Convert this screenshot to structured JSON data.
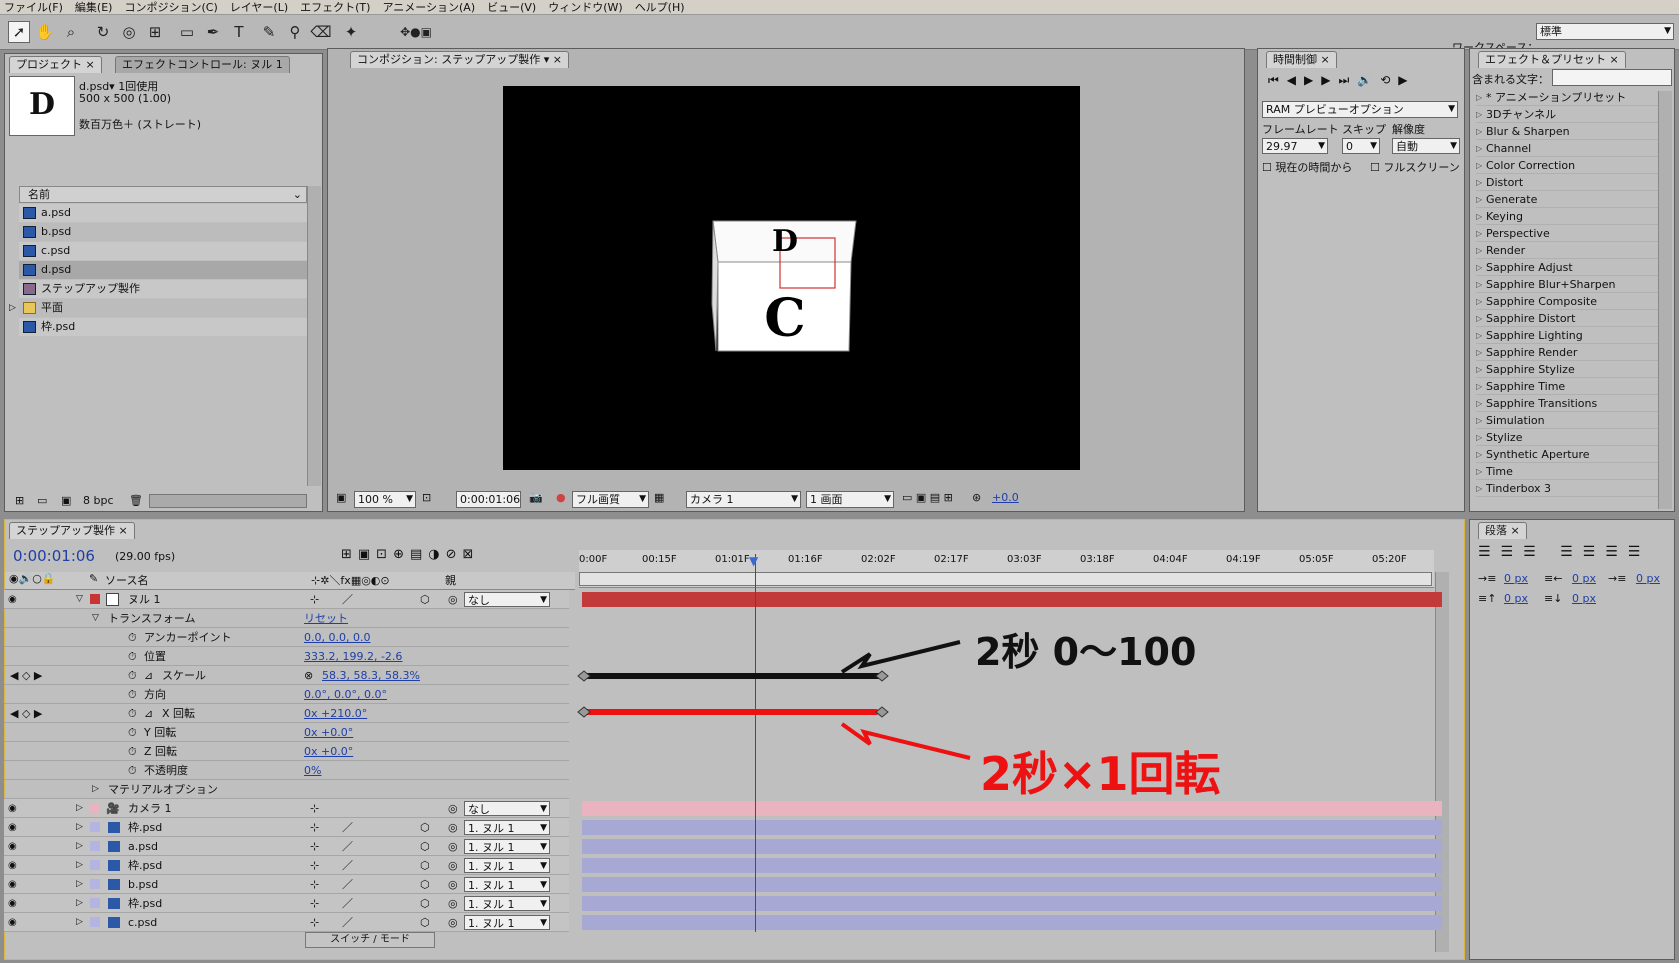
{
  "menu": [
    "ファイル(F)",
    "編集(E)",
    "コンポジション(C)",
    "レイヤー(L)",
    "エフェクト(T)",
    "アニメーション(A)",
    "ビュー(V)",
    "ウィンドウ(W)",
    "ヘルプ(H)"
  ],
  "workspace": {
    "label": "ワークスペース：",
    "value": "標準"
  },
  "project": {
    "tab": "プロジェクト",
    "tab2": "エフェクトコントロール: ヌル 1",
    "thumb_letter": "D",
    "file_name": "d.psd▾ 1回使用",
    "file_dims": "500 x 500 (1.00)",
    "file_color": "数百万色＋ (ストレート)",
    "col_name": "名前",
    "items": [
      {
        "name": "a.psd",
        "type": "psd"
      },
      {
        "name": "b.psd",
        "type": "psd"
      },
      {
        "name": "c.psd",
        "type": "psd"
      },
      {
        "name": "d.psd",
        "type": "psd"
      },
      {
        "name": "ステップアップ製作",
        "type": "comp"
      },
      {
        "name": "平面",
        "type": "folder"
      },
      {
        "name": "枠.psd",
        "type": "psd"
      }
    ],
    "bpc": "8 bpc"
  },
  "comp": {
    "tab": "コンポジション: ステップアップ製作",
    "zoom": "100 %",
    "timecode": "0:00:01:06",
    "quality": "フル画質",
    "camera": "カメラ 1",
    "views": "1 画面",
    "exposure": "+0.0",
    "cube_top": "D",
    "cube_front": "C"
  },
  "time_ctrl": {
    "tab": "時間制御",
    "ram": "RAM プレビューオプション",
    "framerate_label": "フレームレート",
    "skip_label": "スキップ",
    "res_label": "解像度",
    "framerate": "29.97",
    "skip": "0",
    "res": "自動",
    "from_current": "現在の時間から",
    "fullscreen": "フルスクリーン"
  },
  "effects": {
    "tab": "エフェクト＆プリセット",
    "search_label": "含まれる文字：",
    "items": [
      "* アニメーションプリセット",
      "3Dチャンネル",
      "Blur & Sharpen",
      "Channel",
      "Color Correction",
      "Distort",
      "Generate",
      "Keying",
      "Perspective",
      "Render",
      "Sapphire Adjust",
      "Sapphire Blur+Sharpen",
      "Sapphire Composite",
      "Sapphire Distort",
      "Sapphire Lighting",
      "Sapphire Render",
      "Sapphire Stylize",
      "Sapphire Time",
      "Sapphire Transitions",
      "Simulation",
      "Stylize",
      "Synthetic Aperture",
      "Time",
      "Tinderbox 3"
    ]
  },
  "paragraph": {
    "tab": "段落",
    "v1": "0 px",
    "v2": "0 px",
    "v3": "0 px",
    "v4": "0 px",
    "v5": "0 px"
  },
  "timeline": {
    "tab": "ステップアップ製作",
    "timecode": "0:00:01:06",
    "fps": "(29.00 fps)",
    "col_source": "ソース名",
    "col_parent": "親",
    "ruler": [
      "0:00F",
      "00:15F",
      "01:01F",
      "01:16F",
      "02:02F",
      "02:17F",
      "03:03F",
      "03:18F",
      "04:04F",
      "04:19F",
      "05:05F",
      "05:20F"
    ],
    "null_name": "ヌル 1",
    "none": "なし",
    "transform": "トランスフォーム",
    "reset": "リセット",
    "props": [
      {
        "n": "アンカーポイント",
        "v": "0.0, 0.0, 0.0"
      },
      {
        "n": "位置",
        "v": "333.2, 199.2, -2.6"
      },
      {
        "n": "スケール",
        "v": "58.3, 58.3, 58.3%"
      },
      {
        "n": "方向",
        "v": "0.0°, 0.0°, 0.0°"
      },
      {
        "n": "X 回転",
        "v": "0x +210.0°"
      },
      {
        "n": "Y 回転",
        "v": "0x +0.0°"
      },
      {
        "n": "Z 回転",
        "v": "0x +0.0°"
      },
      {
        "n": "不透明度",
        "v": "0%"
      }
    ],
    "material": "マテリアルオプション",
    "layers": [
      {
        "name": "カメラ 1",
        "parent": "なし"
      },
      {
        "name": "枠.psd",
        "parent": "1. ヌル 1"
      },
      {
        "name": "a.psd",
        "parent": "1. ヌル 1"
      },
      {
        "name": "枠.psd",
        "parent": "1. ヌル 1"
      },
      {
        "name": "b.psd",
        "parent": "1. ヌル 1"
      },
      {
        "name": "枠.psd",
        "parent": "1. ヌル 1"
      },
      {
        "name": "c.psd",
        "parent": "1. ヌル 1"
      }
    ],
    "switch_mode": "スイッチ / モード",
    "note_black": "2秒 0〜100",
    "note_red": "2秒×1回転"
  }
}
